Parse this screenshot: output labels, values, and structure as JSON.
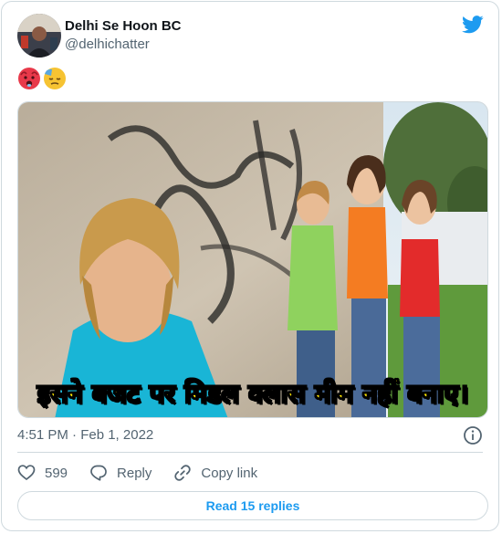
{
  "author": {
    "name": "Delhi Se Hoon BC",
    "handle": "@delhichatter",
    "avatar_icon": "avatar"
  },
  "brand": {
    "icon": "twitter-bird-icon",
    "color": "#1d9bf0"
  },
  "tweet": {
    "emojis": [
      "hot-face-emoji",
      "downcast-face-with-sweat-emoji"
    ],
    "image": {
      "description": "meme-photo",
      "caption": "इसने बजट पर मिडल क्लास मीम नहीं बनाए।"
    },
    "timestamp": "4:51 PM · Feb 1, 2022"
  },
  "actions": {
    "likes_count": "599",
    "reply_label": "Reply",
    "copy_link_label": "Copy link"
  },
  "footer": {
    "read_replies_label": "Read 15 replies"
  },
  "colors": {
    "text_secondary": "#536471",
    "border": "#cfd9de",
    "accent": "#1d9bf0",
    "caption_fill": "#ffe600"
  }
}
